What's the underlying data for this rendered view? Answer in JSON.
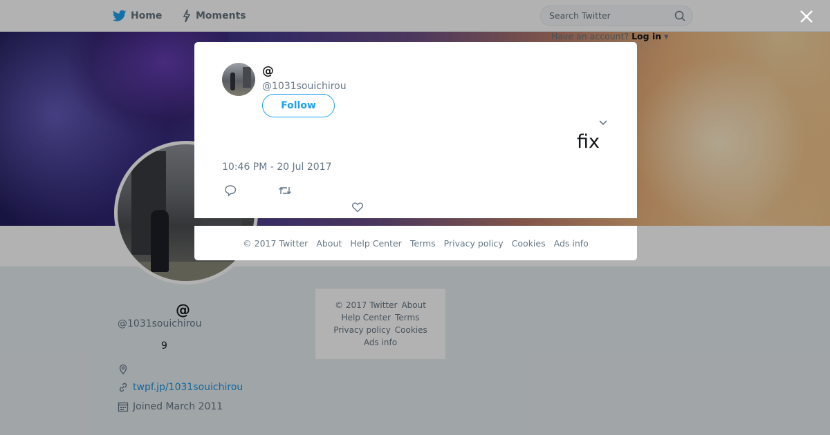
{
  "nav": {
    "home_label": "Home",
    "moments_label": "Moments",
    "search_placeholder": "Search Twitter",
    "account_prompt": "Have an account?",
    "login_label": "Log in"
  },
  "profile": {
    "display_name": "　　　　@　　　　　",
    "handle": "@1031souichirou",
    "stat_value": "9",
    "website": "twpf.jp/1031souichirou",
    "joined": "Joined March 2011"
  },
  "side_footer": {
    "links": [
      "© 2017 Twitter",
      "About",
      "Help Center",
      "Terms",
      "Privacy policy",
      "Cookies",
      "Ads info"
    ]
  },
  "tweet": {
    "name": "@",
    "handle": "@1031souichirou",
    "follow_label": "Follow",
    "text": "　　　　　　　　　　　　　　　　　　　fix　　　　　　　　　　",
    "timestamp": "10:46 PM - 20 Jul 2017"
  },
  "modal_footer": {
    "links": [
      "© 2017 Twitter",
      "About",
      "Help Center",
      "Terms",
      "Privacy policy",
      "Cookies",
      "Ads info"
    ]
  },
  "colors": {
    "accent": "#1da1f2",
    "link": "#1b95e0",
    "muted": "#657786"
  }
}
